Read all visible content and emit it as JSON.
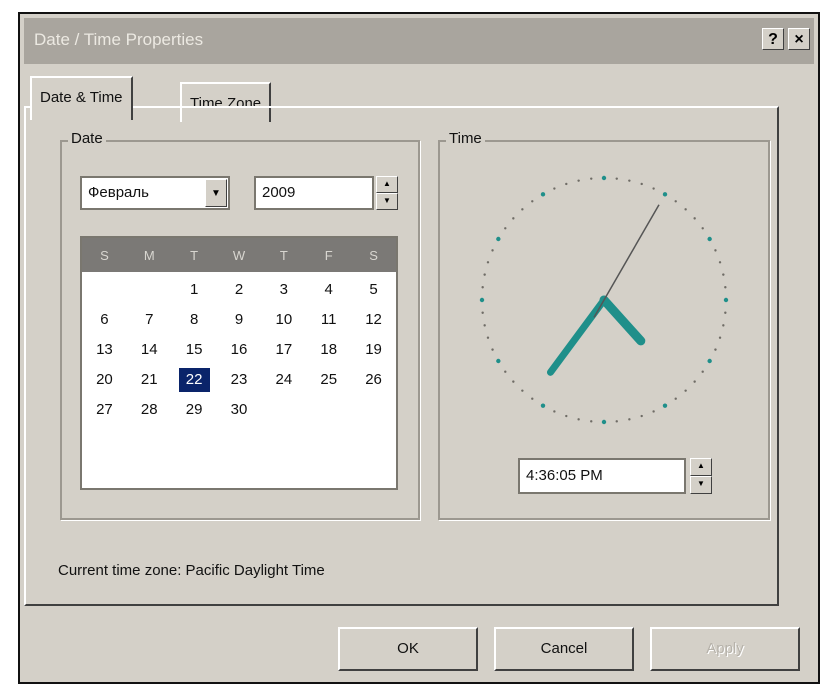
{
  "window": {
    "title": "Date / Time Properties",
    "help_label": "?",
    "close_label": "×"
  },
  "tabs": [
    {
      "label": "Date & Time",
      "active": true
    },
    {
      "label": "Time Zone",
      "active": false
    }
  ],
  "date_group": {
    "label": "Date",
    "month": "Февраль",
    "year": "2009"
  },
  "calendar": {
    "weekday_headers": [
      "S",
      "M",
      "T",
      "W",
      "T",
      "F",
      "S"
    ],
    "selected_day": "22",
    "weeks": [
      [
        "",
        "",
        "1",
        "2",
        "3",
        "4",
        "5"
      ],
      [
        "6",
        "7",
        "8",
        "9",
        "10",
        "11",
        "12"
      ],
      [
        "13",
        "14",
        "15",
        "16",
        "17",
        "18",
        "19"
      ],
      [
        "20",
        "21",
        "22",
        "23",
        "24",
        "25",
        "26"
      ],
      [
        "27",
        "28",
        "29",
        "30",
        "",
        "",
        ""
      ]
    ]
  },
  "time_group": {
    "label": "Time",
    "time_value": "4:36:05 PM"
  },
  "footer": {
    "timezone_text": "Current time zone:  Pacific Daylight Time"
  },
  "buttons": {
    "ok": "OK",
    "cancel": "Cancel",
    "apply": "Apply"
  },
  "colors": {
    "face": "#d4d0c8",
    "selection": "#0a246a",
    "clock_hand": "#1f8f8a"
  }
}
